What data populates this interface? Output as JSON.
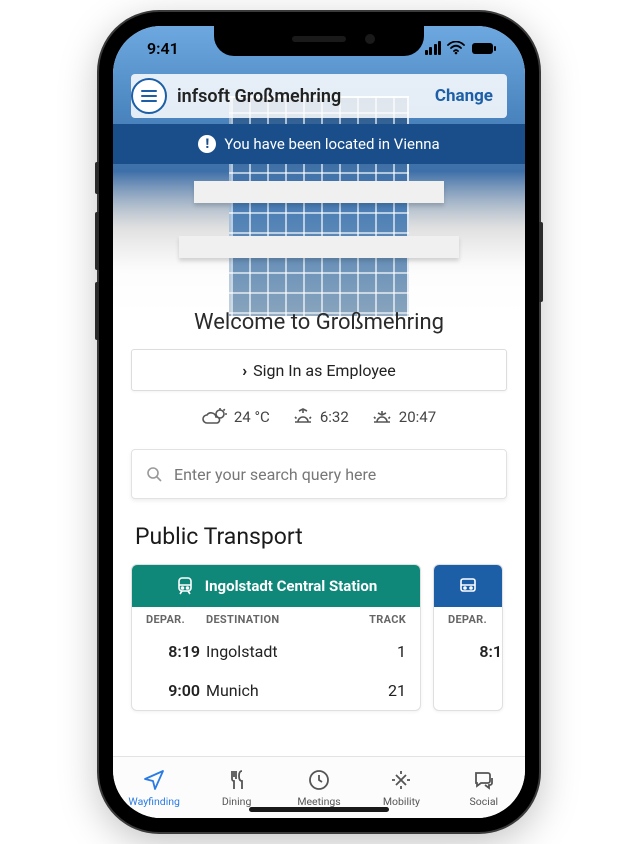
{
  "status": {
    "time": "9:41"
  },
  "header": {
    "title": "infsoft Großmehring",
    "change": "Change"
  },
  "banner": {
    "text": "You have been located in Vienna"
  },
  "welcome": "Welcome to Großmehring",
  "signin_label": "Sign In as Employee",
  "weather": {
    "temp": "24 °C",
    "sunrise": "6:32",
    "sunset": "20:47"
  },
  "search": {
    "placeholder": "Enter your search query here"
  },
  "transport": {
    "heading": "Public Transport",
    "col_depart": "DEPAR.",
    "col_dest": "DESTINATION",
    "col_track": "TRACK",
    "station1": {
      "name": "Ingolstadt Central Station",
      "rows": [
        {
          "time": "8:19",
          "dest": "Ingolstadt",
          "track": "1"
        },
        {
          "time": "9:00",
          "dest": "Munich",
          "track": "21"
        }
      ]
    },
    "station2": {
      "partial_time": "8:1"
    }
  },
  "tabs": {
    "wayfinding": "Wayfinding",
    "dining": "Dining",
    "meetings": "Meetings",
    "mobility": "Mobility",
    "social": "Social"
  }
}
